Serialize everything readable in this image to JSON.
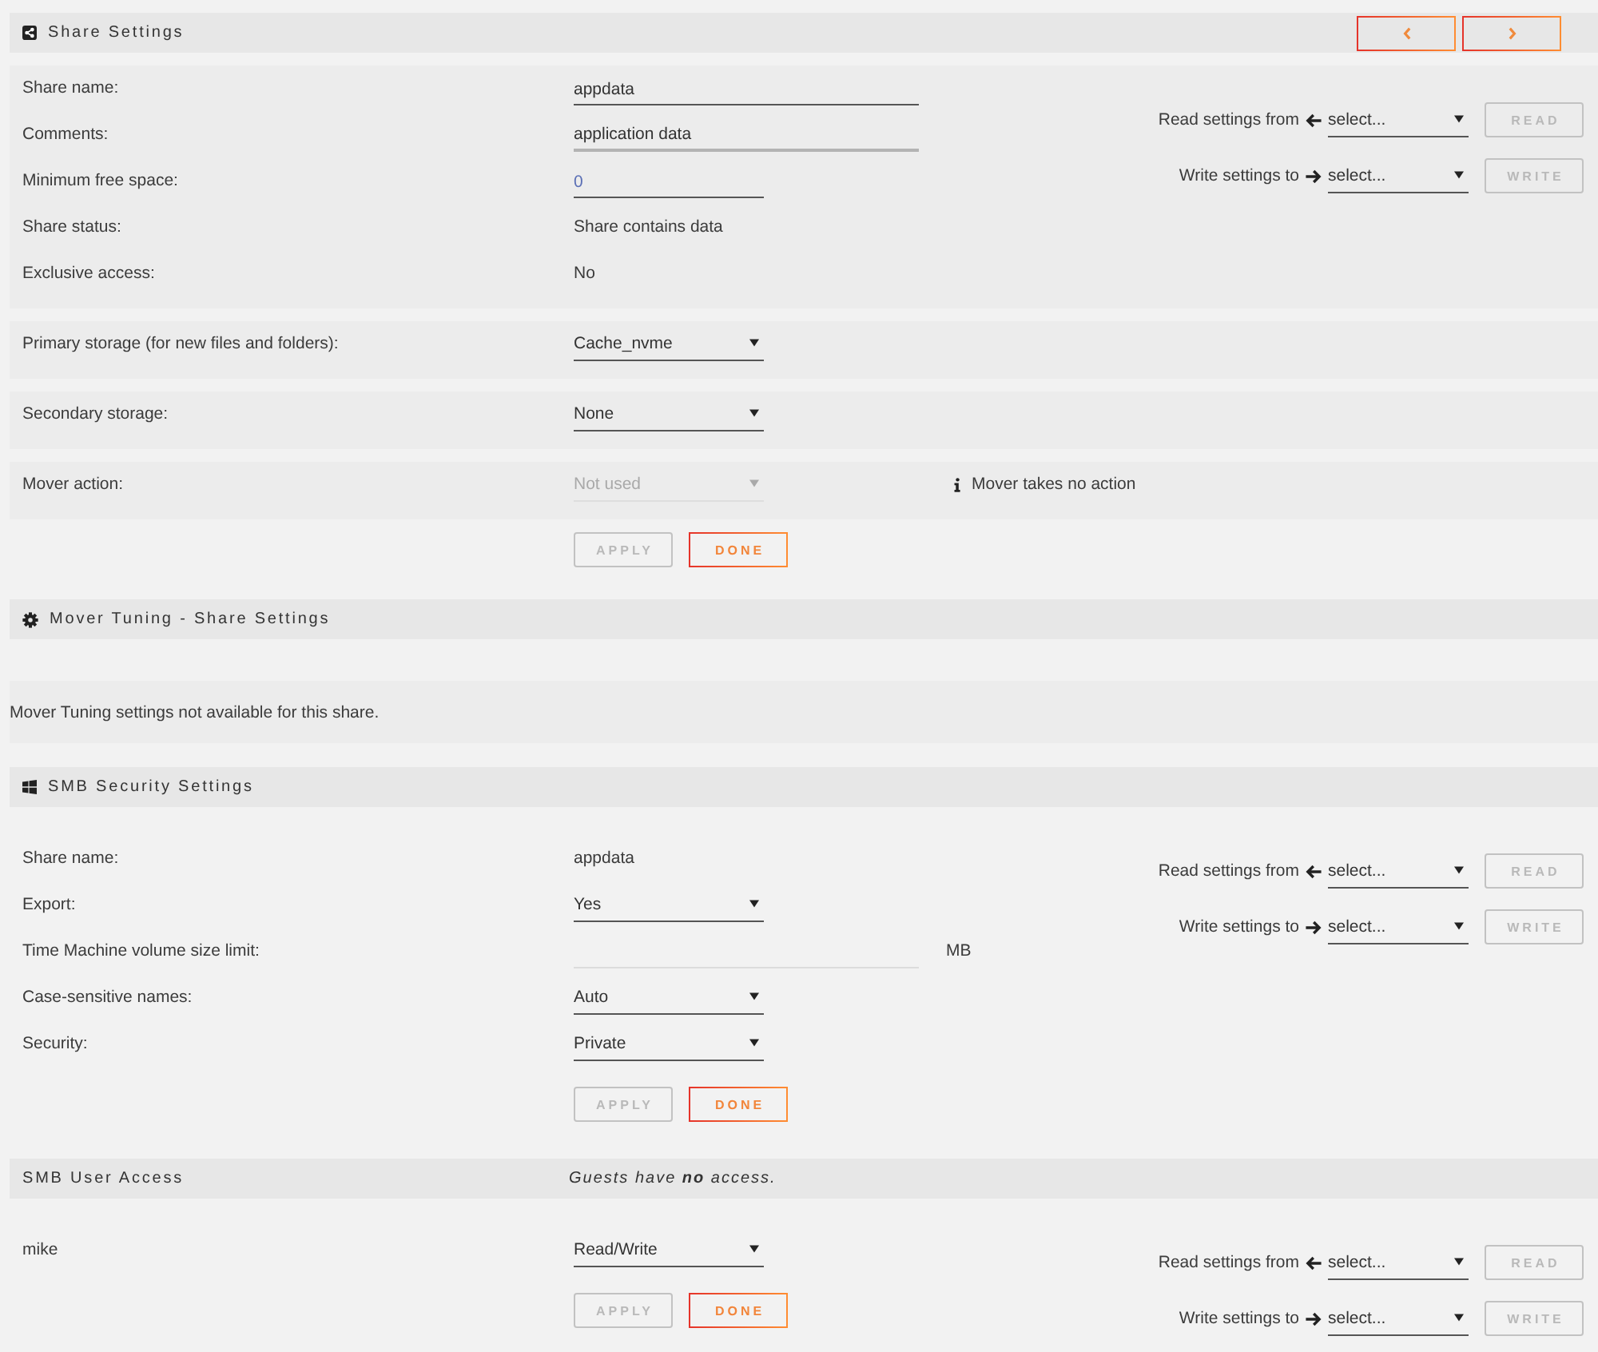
{
  "sections": [
    {
      "kind": "header",
      "title": "Share Settings",
      "nav_buttons": [
        {
          "kind": "previous"
        },
        {
          "kind": "next"
        }
      ]
    },
    {
      "kind": "panel",
      "rows": [
        {
          "label": "Share name:",
          "control": {
            "kind": "input",
            "value": "appdata",
            "focused": false,
            "disabled": false
          }
        },
        {
          "label": "Comments:",
          "control": {
            "kind": "input",
            "value": "application data",
            "focused": true,
            "disabled": false
          }
        },
        {
          "label": "Minimum free space:",
          "control": {
            "kind": "short_input",
            "placeholder": "0",
            "focused": false,
            "disabled": false
          }
        },
        {
          "label": "Share status:",
          "control": {
            "kind": "text",
            "value": "Share contains data"
          }
        },
        {
          "label": "Exclusive access:",
          "control": {
            "kind": "text",
            "value": "No"
          }
        }
      ],
      "copy_settings": [
        {
          "kind": "read",
          "label": "Read settings from",
          "select": "select...",
          "button": {
            "label": "READ",
            "disabled": true
          }
        },
        {
          "kind": "write",
          "label": "Write settings to",
          "select": "select...",
          "button": {
            "label": "WRITE",
            "disabled": true
          }
        }
      ]
    },
    {
      "kind": "panel",
      "rows": [
        {
          "label": "Primary storage (for new files and folders):",
          "control": {
            "kind": "select",
            "value": "Cache_nvme",
            "disabled": false
          }
        }
      ]
    },
    {
      "kind": "panel",
      "rows": [
        {
          "label": "Secondary storage:",
          "control": {
            "kind": "select",
            "value": "None",
            "disabled": false
          }
        }
      ]
    },
    {
      "kind": "panel",
      "rows": [
        {
          "label": "Mover action:",
          "control": {
            "kind": "select",
            "value": "Not used",
            "disabled": true
          },
          "hint": "Mover takes no action"
        }
      ]
    },
    {
      "kind": "actions",
      "buttons": [
        {
          "label": "APPLY",
          "disabled": true
        },
        {
          "label": "DONE",
          "disabled": false
        }
      ]
    },
    {
      "kind": "header",
      "title": "Mover Tuning - Share Settings"
    },
    {
      "kind": "note",
      "text": "Mover Tuning settings not available for this share."
    },
    {
      "kind": "header",
      "title": "SMB Security Settings"
    },
    {
      "kind": "plain",
      "rows": [
        {
          "label": "Share name:",
          "control": {
            "kind": "text",
            "value": "appdata"
          }
        },
        {
          "label": "Export:",
          "control": {
            "kind": "select",
            "value": "Yes",
            "disabled": false
          }
        },
        {
          "label": "Time Machine volume size limit:",
          "control": {
            "kind": "input",
            "focused": false,
            "disabled": true
          },
          "unit": "MB"
        },
        {
          "label": "Case-sensitive names:",
          "control": {
            "kind": "select",
            "value": "Auto",
            "disabled": false
          }
        },
        {
          "label": "Security:",
          "control": {
            "kind": "select",
            "value": "Private",
            "disabled": false
          }
        }
      ],
      "buttons": [
        {
          "label": "APPLY",
          "disabled": true
        },
        {
          "label": "DONE",
          "disabled": false
        }
      ],
      "copy_settings": [
        {
          "kind": "read",
          "label": "Read settings from",
          "select": "select...",
          "button": {
            "label": "READ",
            "disabled": true
          }
        },
        {
          "kind": "write",
          "label": "Write settings to",
          "select": "select...",
          "button": {
            "label": "WRITE",
            "disabled": true
          }
        }
      ]
    },
    {
      "kind": "header",
      "title": "SMB User Access",
      "note": "Guests have **no** access."
    },
    {
      "kind": "plain",
      "rows": [
        {
          "label": "mike",
          "control": {
            "kind": "select",
            "value": "Read/Write",
            "disabled": false
          }
        }
      ],
      "buttons": [
        {
          "label": "APPLY",
          "disabled": true
        },
        {
          "label": "DONE",
          "disabled": false
        }
      ],
      "copy_settings": [
        {
          "kind": "read",
          "label": "Read settings from",
          "select": "select...",
          "button": {
            "label": "READ",
            "disabled": true
          }
        },
        {
          "kind": "write",
          "label": "Write settings to",
          "select": "select...",
          "button": {
            "label": "WRITE",
            "disabled": true
          }
        }
      ]
    }
  ]
}
